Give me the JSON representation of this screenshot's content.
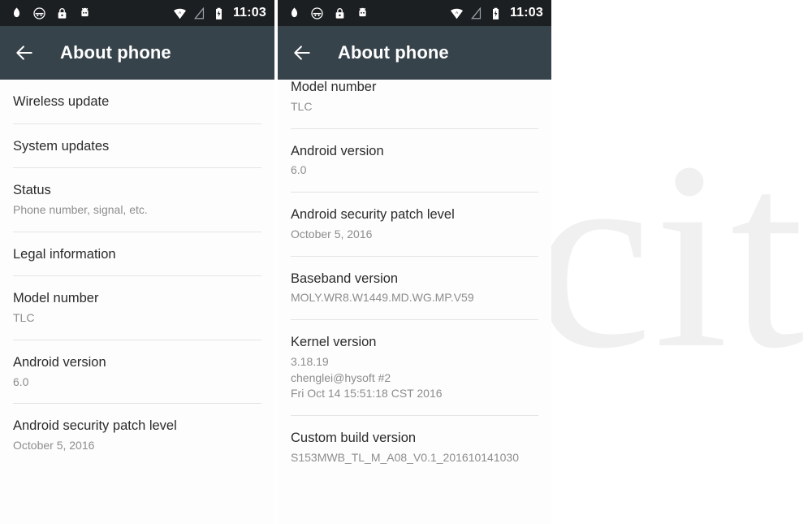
{
  "watermark": {
    "text": "Ktuccit"
  },
  "colors": {
    "status_bar": "#1c1f22",
    "app_bar": "#37434b",
    "panel_background": "#fafafa",
    "title_text": "#2b2b2b",
    "secondary_text": "#8d8d8d",
    "divider": "#e4e4e4"
  },
  "status_bar": {
    "time": "11:03",
    "left_icons": [
      {
        "name": "blob-notification-icon"
      },
      {
        "name": "face-notification-icon"
      },
      {
        "name": "lock-icon"
      },
      {
        "name": "android-robot-icon"
      }
    ],
    "right_icons": [
      {
        "name": "wifi-icon"
      },
      {
        "name": "signal-no-service-icon"
      },
      {
        "name": "battery-charging-icon"
      }
    ]
  },
  "panels": [
    {
      "id": "left",
      "app_bar": {
        "back_label": "back-arrow",
        "title": "About phone"
      },
      "rows": [
        {
          "title": "Wireless update",
          "sub": []
        },
        {
          "title": "System updates",
          "sub": []
        },
        {
          "title": "Status",
          "sub": [
            "Phone number, signal, etc."
          ]
        },
        {
          "title": "Legal information",
          "sub": []
        },
        {
          "title": "Model number",
          "sub": [
            "TLC"
          ]
        },
        {
          "title": "Android version",
          "sub": [
            "6.0"
          ]
        },
        {
          "title": "Android security patch level",
          "sub": [
            "October 5, 2016"
          ]
        }
      ]
    },
    {
      "id": "right",
      "app_bar": {
        "back_label": "back-arrow",
        "title": "About phone"
      },
      "rows": [
        {
          "title": "Model number",
          "sub": [
            "TLC"
          ]
        },
        {
          "title": "Android version",
          "sub": [
            "6.0"
          ]
        },
        {
          "title": "Android security patch level",
          "sub": [
            "October 5, 2016"
          ]
        },
        {
          "title": "Baseband version",
          "sub": [
            "MOLY.WR8.W1449.MD.WG.MP.V59"
          ]
        },
        {
          "title": "Kernel version",
          "sub": [
            "3.18.19",
            "chenglei@hysoft #2",
            "Fri Oct 14 15:51:18 CST 2016"
          ]
        },
        {
          "title": "Custom build version",
          "sub": [
            "S153MWB_TL_M_A08_V0.1_201610141030"
          ]
        }
      ]
    }
  ]
}
